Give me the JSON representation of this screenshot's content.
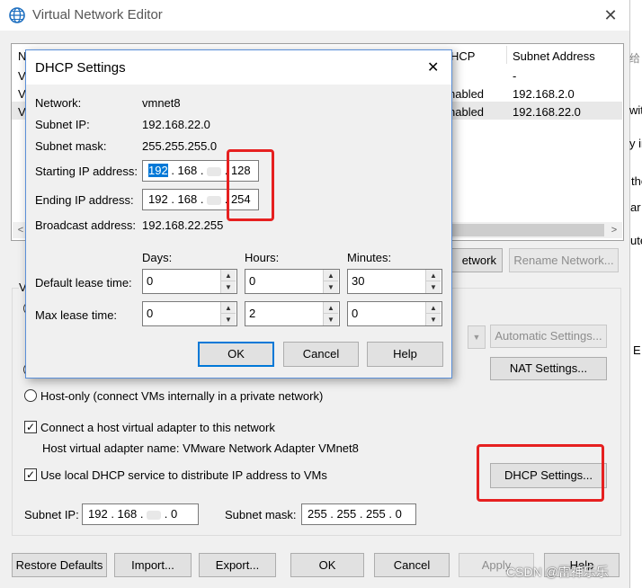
{
  "main": {
    "title": "Virtual Network Editor",
    "table": {
      "headers": [
        "N",
        "HCP",
        "Subnet Address"
      ],
      "rows": [
        {
          "first": "V",
          "dhcp": "",
          "subnet": "-"
        },
        {
          "first": "V",
          "dhcp": "nabled",
          "subnet": "192.168.2.0"
        },
        {
          "first": "V",
          "dhcp": "nabled",
          "subnet": "192.168.22.0"
        }
      ]
    },
    "buttons": {
      "network_partial": "etwork",
      "rename_network": "Rename Network...",
      "automatic_settings": "Automatic Settings...",
      "nat_settings": "NAT Settings...",
      "dhcp_settings": "DHCP Settings...",
      "restore_defaults": "Restore Defaults",
      "import": "Import...",
      "export": "Export...",
      "ok": "OK",
      "cancel": "Cancel",
      "apply": "Apply",
      "help": "Help"
    },
    "group_letter": "V",
    "host_only_label": "Host-only (connect VMs internally in a private network)",
    "connect_adapter_label": "Connect a host virtual adapter to this network",
    "adapter_name_label": "Host virtual adapter name: VMware Network Adapter VMnet8",
    "use_dhcp_label": "Use local DHCP service to distribute IP address to VMs",
    "subnet_ip_label": "Subnet IP:",
    "subnet_ip_parts": [
      "192",
      "168",
      "0"
    ],
    "subnet_mask_label": "Subnet mask:",
    "subnet_mask_value": "255 . 255 . 255 .  0",
    "right_edge_text": [
      "给",
      "with",
      "y in",
      "the",
      "ar",
      "ute",
      "E"
    ]
  },
  "dialog": {
    "title": "DHCP Settings",
    "close_glyph": "✕",
    "network_label": "Network:",
    "network_value": "vmnet8",
    "subnet_ip_label": "Subnet IP:",
    "subnet_ip_value": "192.168.22.0",
    "subnet_mask_label": "Subnet mask:",
    "subnet_mask_value": "255.255.255.0",
    "starting_ip_label": "Starting IP address:",
    "starting_ip_parts": [
      "192",
      "168",
      "128"
    ],
    "ending_ip_label": "Ending IP address:",
    "ending_ip_parts": [
      "192",
      "168",
      "254"
    ],
    "broadcast_label": "Broadcast address:",
    "broadcast_value": "192.168.22.255",
    "days_label": "Days:",
    "hours_label": "Hours:",
    "minutes_label": "Minutes:",
    "default_lease_label": "Default lease time:",
    "max_lease_label": "Max lease time:",
    "default_lease": {
      "days": "0",
      "hours": "0",
      "minutes": "30"
    },
    "max_lease": {
      "days": "0",
      "hours": "2",
      "minutes": "0"
    },
    "ok_label": "OK",
    "cancel_label": "Cancel",
    "help_label": "Help"
  },
  "watermark": "CSDN @雷神乐乐",
  "colors": {
    "accent": "#0078d7",
    "highlight_red": "#e62020",
    "selection": "#0078d7"
  },
  "icons": {
    "app": "globe-network-icon",
    "close": "close-icon",
    "spin_up": "spin-up-icon",
    "spin_down": "spin-down-icon"
  }
}
